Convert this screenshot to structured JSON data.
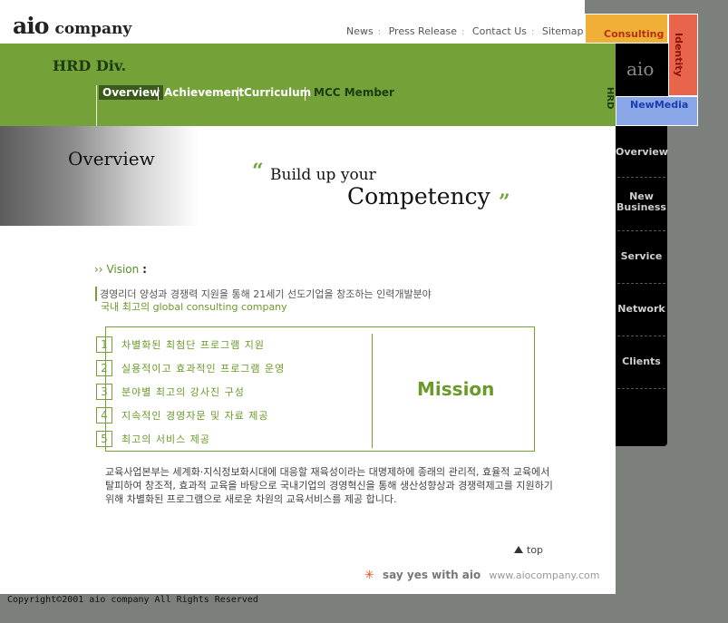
{
  "brand": {
    "logo_main": "aio",
    "logo_sub": "company"
  },
  "top_nav": [
    "News",
    "Press Release",
    "Contact Us",
    "Sitemap"
  ],
  "division": "HRD Div.",
  "sub_nav": [
    "Overview",
    "Achievement",
    "Curriculum",
    "MCC Member"
  ],
  "side_label": "HRD",
  "corner_blocks": {
    "consulting": "Consulting",
    "aio": "aio",
    "identity": "Identity",
    "newmedia": "NewMedia"
  },
  "side_menu": [
    "Overview",
    "New Business",
    "Service",
    "Network",
    "Clients"
  ],
  "hero": {
    "overview_title": "Overview",
    "headline_1": "Build up your",
    "headline_2": "Competency",
    "quote_open": "“",
    "quote_close": "”"
  },
  "vision": {
    "label": "Vision",
    "line1": "경영리더 양성과 경쟁력 지원을 통해 21세기 선도기업을 창조하는 인력개발분야",
    "line2": "국내 최고의 global consulting company"
  },
  "mission": {
    "title": "Mission",
    "items": [
      {
        "num": "1",
        "text": "차별화된 최첨단 프로그램 지원"
      },
      {
        "num": "2",
        "text": "실용적이고 효과적인 프로그램 운영"
      },
      {
        "num": "3",
        "text": "분야별 최고의 강사진 구성"
      },
      {
        "num": "4",
        "text": "지속적인 경영자문 및 자료 제공"
      },
      {
        "num": "5",
        "text": "최고의 서비스 제공"
      }
    ]
  },
  "description": "교육사업본부는 세계화·지식정보화시대에 대응할 재육성이라는 대명제하에 종래의 관리적, 효율적 교육에서 탈피하여 창조적, 효과적 교육을 바탕으로 국내기업의 경영혁신을 통해 생산성향상과 경쟁력제고를 지원하기 위해 차별화된 프로그램으로 새로운 차원의 교육서비스를 제공 합니다.",
  "footer": {
    "top_link": "top",
    "slogan": "say yes with aio",
    "url": "www.aiocompany.com",
    "copyright": "Copyright©2001 aio company All Rights Reserved"
  },
  "colors": {
    "green": "#74a238",
    "orange": "#f0b038",
    "red": "#e8654c",
    "blue": "#8aa8e8",
    "background": "#7c807c"
  }
}
